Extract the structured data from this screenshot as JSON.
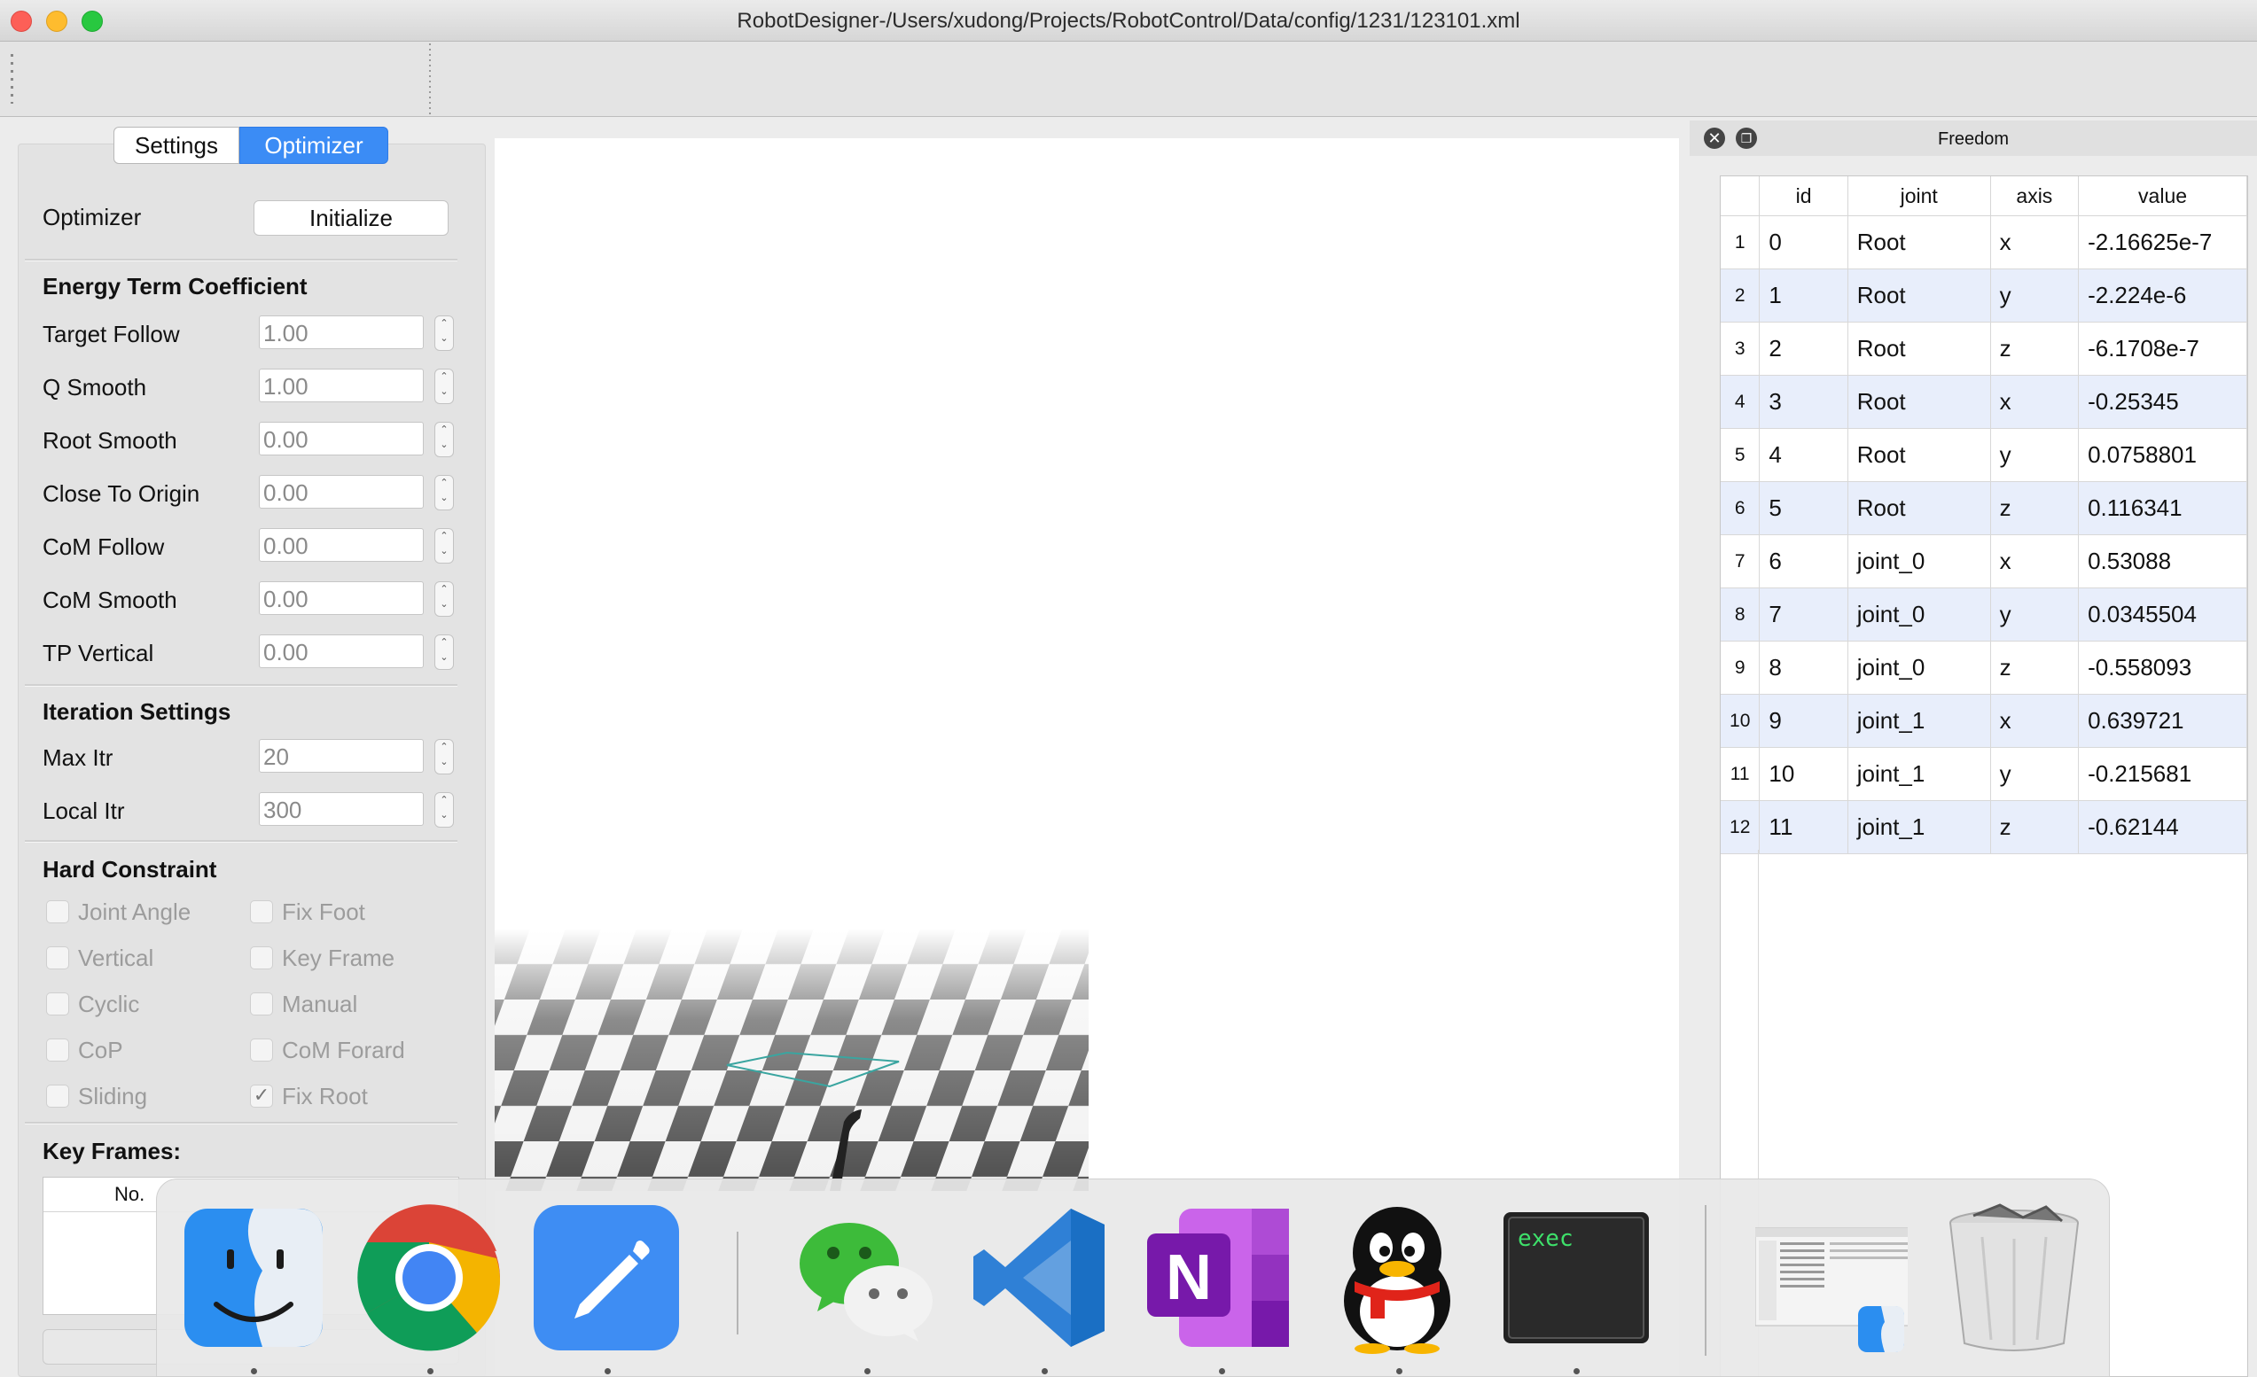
{
  "window": {
    "title": "RobotDesigner-/Users/xudong/Projects/RobotControl/Data/config/1231/123101.xml",
    "close_color": "#fd5f57",
    "minimize_color": "#febc2e",
    "maximize_color": "#28c840"
  },
  "tabs": [
    {
      "label": "Settings",
      "active": false
    },
    {
      "label": "Optimizer",
      "active": true
    }
  ],
  "optimizer": {
    "label": "Optimizer",
    "initialize_label": "Initialize"
  },
  "energy": {
    "title": "Energy Term Coefficient",
    "fields": [
      {
        "label": "Target Follow",
        "value": "1.00"
      },
      {
        "label": "Q Smooth",
        "value": "1.00"
      },
      {
        "label": "Root Smooth",
        "value": "0.00"
      },
      {
        "label": "Close To Origin",
        "value": "0.00"
      },
      {
        "label": "CoM Follow",
        "value": "0.00"
      },
      {
        "label": "CoM Smooth",
        "value": "0.00"
      },
      {
        "label": "TP Vertical",
        "value": "0.00"
      }
    ]
  },
  "iteration": {
    "title": "Iteration Settings",
    "fields": [
      {
        "label": "Max Itr",
        "value": "20"
      },
      {
        "label": "Local Itr",
        "value": "300"
      }
    ]
  },
  "hard_constraint": {
    "title": "Hard Constraint",
    "items": [
      {
        "label": "Joint Angle",
        "checked": false
      },
      {
        "label": "Fix Foot",
        "checked": false
      },
      {
        "label": "Vertical",
        "checked": false
      },
      {
        "label": "Key Frame",
        "checked": false
      },
      {
        "label": "Cyclic",
        "checked": false
      },
      {
        "label": "Manual",
        "checked": false
      },
      {
        "label": "CoP",
        "checked": false
      },
      {
        "label": "CoM Forard",
        "checked": false
      },
      {
        "label": "Sliding",
        "checked": false
      },
      {
        "label": "Fix Root",
        "checked": true
      }
    ]
  },
  "key_frames": {
    "title": "Key Frames:",
    "column": "No."
  },
  "freedom": {
    "title": "Freedom",
    "columns": [
      "id",
      "joint",
      "axis",
      "value"
    ],
    "rows": [
      [
        "1",
        "0",
        "Root",
        "x",
        "-2.16625e-7"
      ],
      [
        "2",
        "1",
        "Root",
        "y",
        "-2.224e-6"
      ],
      [
        "3",
        "2",
        "Root",
        "z",
        "-6.1708e-7"
      ],
      [
        "4",
        "3",
        "Root",
        "x",
        "-0.25345"
      ],
      [
        "5",
        "4",
        "Root",
        "y",
        "0.0758801"
      ],
      [
        "6",
        "5",
        "Root",
        "z",
        "0.116341"
      ],
      [
        "7",
        "6",
        "joint_0",
        "x",
        "0.53088"
      ],
      [
        "8",
        "7",
        "joint_0",
        "y",
        "0.0345504"
      ],
      [
        "9",
        "8",
        "joint_0",
        "z",
        "-0.558093"
      ],
      [
        "10",
        "9",
        "joint_1",
        "x",
        "0.639721"
      ],
      [
        "11",
        "10",
        "joint_1",
        "y",
        "-0.215681"
      ],
      [
        "12",
        "11",
        "joint_1",
        "z",
        "-0.62144"
      ]
    ]
  },
  "dock": {
    "items": [
      {
        "name": "finder-icon"
      },
      {
        "name": "chrome-icon"
      },
      {
        "name": "notes-icon"
      },
      {
        "name": "wechat-icon"
      },
      {
        "name": "vscode-icon"
      },
      {
        "name": "onenote-icon",
        "label": "N"
      },
      {
        "name": "qq-icon"
      },
      {
        "name": "terminal-icon",
        "label": "exec"
      },
      {
        "name": "finder-window-icon"
      },
      {
        "name": "trash-icon"
      }
    ]
  }
}
